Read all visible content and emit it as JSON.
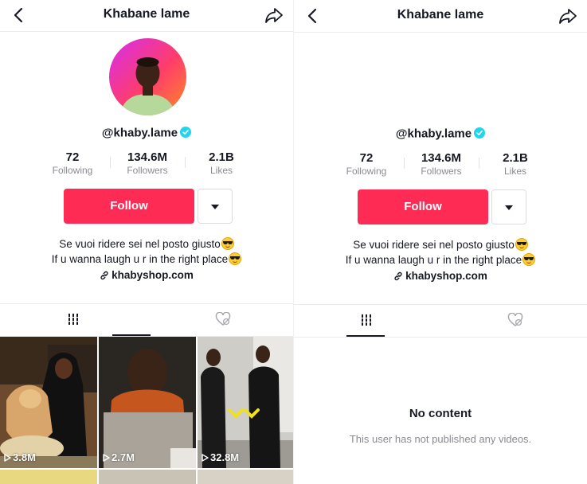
{
  "left_panel": {
    "header": {
      "title": "Khabane lame"
    },
    "profile": {
      "username": "@khaby.lame",
      "stats": [
        {
          "value": "72",
          "label": "Following"
        },
        {
          "value": "134.6M",
          "label": "Followers"
        },
        {
          "value": "2.1B",
          "label": "Likes"
        }
      ],
      "follow_label": "Follow",
      "bio_line1": "Se vuoi ridere sei nel posto giusto",
      "bio_line2": "If u wanna laugh u r in the right place",
      "link": "khabyshop.com"
    },
    "videos": [
      {
        "views": "3.8M"
      },
      {
        "views": "2.7M"
      },
      {
        "views": "32.8M"
      }
    ]
  },
  "right_panel": {
    "header": {
      "title": "Khabane lame"
    },
    "profile": {
      "username": "@khaby.lame",
      "stats": [
        {
          "value": "72",
          "label": "Following"
        },
        {
          "value": "134.6M",
          "label": "Followers"
        },
        {
          "value": "2.1B",
          "label": "Likes"
        }
      ],
      "follow_label": "Follow",
      "bio_line1": "Se vuoi ridere sei nel posto giusto",
      "bio_line2": "If u wanna laugh u r in the right place",
      "link": "khabyshop.com"
    },
    "empty_state": {
      "title": "No content",
      "subtitle": "This user has not published any videos."
    }
  },
  "colors": {
    "accent": "#fe2c55",
    "verified": "#20d5ec",
    "muted_text": "#8a8b91"
  },
  "icons": [
    "back-arrow-icon",
    "share-icon",
    "verified-badge-icon",
    "dropdown-triangle-icon",
    "link-icon",
    "videos-grid-icon",
    "liked-hidden-icon",
    "play-icon",
    "sunglasses-emoji"
  ]
}
